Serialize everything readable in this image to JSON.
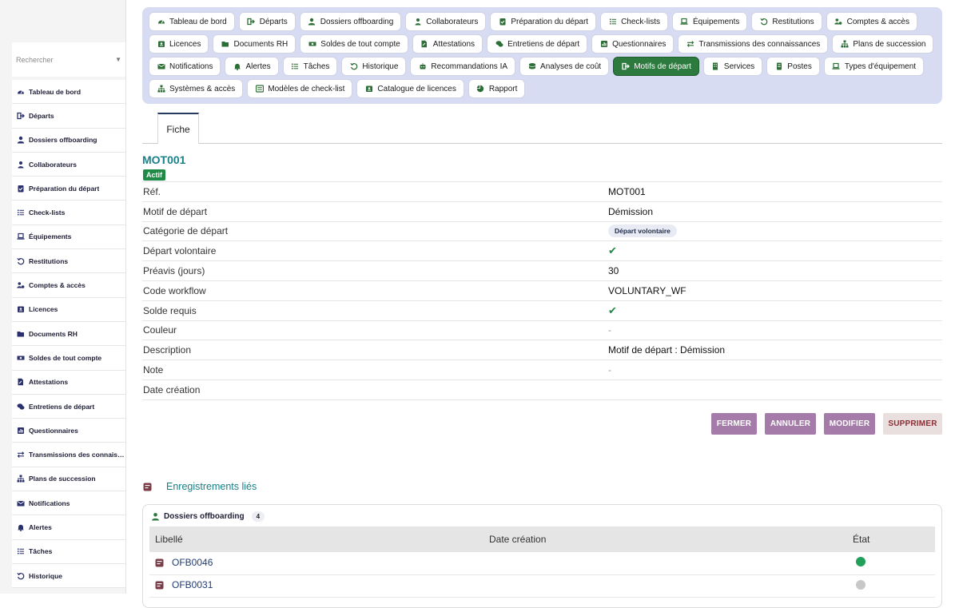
{
  "sidebar": {
    "search_placeholder": "Rechercher",
    "items": [
      {
        "label": "Tableau de bord",
        "icon": "gauge-icon"
      },
      {
        "label": "Départs",
        "icon": "sign-out-icon"
      },
      {
        "label": "Dossiers offboarding",
        "icon": "user-folder-icon"
      },
      {
        "label": "Collaborateurs",
        "icon": "user-icon"
      },
      {
        "label": "Préparation du départ",
        "icon": "clipboard-check-icon"
      },
      {
        "label": "Check-lists",
        "icon": "list-icon"
      },
      {
        "label": "Équipements",
        "icon": "laptop-icon"
      },
      {
        "label": "Restitutions",
        "icon": "undo-icon"
      },
      {
        "label": "Comptes & accès",
        "icon": "users-cog-icon"
      },
      {
        "label": "Licences",
        "icon": "id-badge-icon"
      },
      {
        "label": "Documents RH",
        "icon": "folder-open-icon"
      },
      {
        "label": "Soldes de tout compte",
        "icon": "money-bill-icon"
      },
      {
        "label": "Attestations",
        "icon": "file-signature-icon"
      },
      {
        "label": "Entretiens de départ",
        "icon": "comments-icon"
      },
      {
        "label": "Questionnaires",
        "icon": "poll-icon"
      },
      {
        "label": "Transmissions des connaissances",
        "icon": "exchange-icon"
      },
      {
        "label": "Plans de succession",
        "icon": "sitemap-icon"
      },
      {
        "label": "Notifications",
        "icon": "envelope-icon"
      },
      {
        "label": "Alertes",
        "icon": "bell-icon"
      },
      {
        "label": "Tâches",
        "icon": "tasks-icon"
      },
      {
        "label": "Historique",
        "icon": "history-icon"
      }
    ]
  },
  "topnav": {
    "items": [
      {
        "label": "Tableau de bord",
        "icon": "gauge-icon"
      },
      {
        "label": "Départs",
        "icon": "sign-out-icon"
      },
      {
        "label": "Dossiers offboarding",
        "icon": "user-folder-icon"
      },
      {
        "label": "Collaborateurs",
        "icon": "user-icon"
      },
      {
        "label": "Préparation du départ",
        "icon": "clipboard-check-icon"
      },
      {
        "label": "Check-lists",
        "icon": "list-icon"
      },
      {
        "label": "Équipements",
        "icon": "laptop-icon"
      },
      {
        "label": "Restitutions",
        "icon": "undo-icon"
      },
      {
        "label": "Comptes & accès",
        "icon": "users-cog-icon"
      },
      {
        "label": "Licences",
        "icon": "id-badge-icon"
      },
      {
        "label": "Documents RH",
        "icon": "folder-open-icon"
      },
      {
        "label": "Soldes de tout compte",
        "icon": "money-bill-icon"
      },
      {
        "label": "Attestations",
        "icon": "file-signature-icon"
      },
      {
        "label": "Entretiens de départ",
        "icon": "comments-icon"
      },
      {
        "label": "Questionnaires",
        "icon": "poll-icon"
      },
      {
        "label": "Transmissions des connaissances",
        "icon": "exchange-icon"
      },
      {
        "label": "Plans de succession",
        "icon": "sitemap-icon"
      },
      {
        "label": "Notifications",
        "icon": "envelope-icon"
      },
      {
        "label": "Alertes",
        "icon": "bell-icon"
      },
      {
        "label": "Tâches",
        "icon": "tasks-icon"
      },
      {
        "label": "Historique",
        "icon": "history-icon"
      },
      {
        "label": "Recommandations IA",
        "icon": "robot-icon"
      },
      {
        "label": "Analyses de coût",
        "icon": "coins-icon"
      },
      {
        "label": "Motifs de départ",
        "icon": "sign-out-icon",
        "active": true
      },
      {
        "label": "Services",
        "icon": "building-icon"
      },
      {
        "label": "Postes",
        "icon": "briefcase-icon"
      },
      {
        "label": "Types d'équipement",
        "icon": "laptop-icon"
      },
      {
        "label": "Systèmes & accès",
        "icon": "network-icon"
      },
      {
        "label": "Modèles de check-list",
        "icon": "list-alt-icon"
      },
      {
        "label": "Catalogue de licences",
        "icon": "id-card-icon"
      },
      {
        "label": "Rapport",
        "icon": "pie-chart-icon"
      }
    ]
  },
  "tabs": {
    "active_label": "Fiche"
  },
  "record": {
    "title": "MOT001",
    "status": "Actif",
    "fields": [
      {
        "label": "Réf.",
        "type": "text",
        "value": "MOT001"
      },
      {
        "label": "Motif de départ",
        "type": "text",
        "value": "Démission"
      },
      {
        "label": "Catégorie de départ",
        "type": "pill",
        "value": "Départ volontaire"
      },
      {
        "label": "Départ volontaire",
        "type": "check",
        "value": "✔"
      },
      {
        "label": "Préavis (jours)",
        "type": "text",
        "value": "30"
      },
      {
        "label": "Code workflow",
        "type": "text",
        "value": "VOLUNTARY_WF"
      },
      {
        "label": "Solde requis",
        "type": "check",
        "value": "✔"
      },
      {
        "label": "Couleur",
        "type": "empty",
        "value": "-"
      },
      {
        "label": "Description",
        "type": "text",
        "value": "Motif de départ : Démission"
      },
      {
        "label": "Note",
        "type": "empty",
        "value": "-"
      },
      {
        "label": "Date création",
        "type": "text",
        "value": ""
      }
    ]
  },
  "actions": {
    "close": "FERMER",
    "cancel": "ANNULER",
    "edit": "MODIFIER",
    "delete": "SUPPRIMER"
  },
  "related": {
    "title": "Enregistrements liés",
    "panel_title": "Dossiers offboarding",
    "count": "4",
    "columns": {
      "label": "Libellé",
      "date": "Date création",
      "state": "État"
    },
    "rows": [
      {
        "label": "OFB0046",
        "date": "",
        "state_color": "#21a05a"
      },
      {
        "label": "OFB0031",
        "date": "",
        "state_color": "#c8c8c8"
      }
    ]
  },
  "colors": {
    "accent": "#188087",
    "active_chip": "#2c7a3d",
    "action_button": "#a57ba9",
    "check": "#1f8a45"
  }
}
